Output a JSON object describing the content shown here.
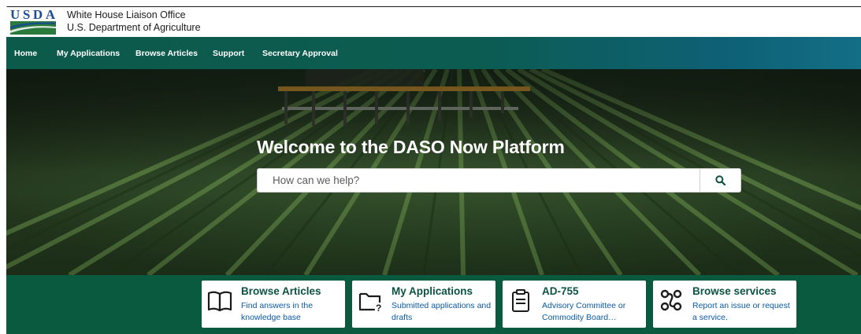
{
  "header": {
    "logo_text": "USDA",
    "org_line1": "White House Liaison Office",
    "org_line2": "U.S. Department of Agriculture"
  },
  "nav": {
    "items": [
      {
        "label": "Home"
      },
      {
        "label": "My Applications"
      },
      {
        "label": "Browse Articles"
      },
      {
        "label": "Support"
      },
      {
        "label": "Secretary Approval"
      }
    ]
  },
  "hero": {
    "title": "Welcome to the DASO Now Platform",
    "search_placeholder": "How can we help?",
    "search_icon": "search-icon"
  },
  "cards": [
    {
      "icon": "book-icon",
      "title": "Browse Articles",
      "desc": "Find answers in the knowledge base"
    },
    {
      "icon": "folder-question-icon",
      "title": "My Applications",
      "desc": "Submitted applications and drafts"
    },
    {
      "icon": "clipboard-icon",
      "title": "AD-755",
      "desc": "Advisory Committee or Commodity Board…"
    },
    {
      "icon": "workflow-icon",
      "title": "Browse services",
      "desc": "Report an issue or request a service."
    }
  ],
  "colors": {
    "nav_start": "#0b5a4a",
    "nav_end": "#136f86",
    "band": "#0a5a40",
    "card_title": "#0b5242",
    "card_desc": "#0b5aa6",
    "usda_blue": "#1a4d8f",
    "usda_green": "#2a7a3b"
  }
}
